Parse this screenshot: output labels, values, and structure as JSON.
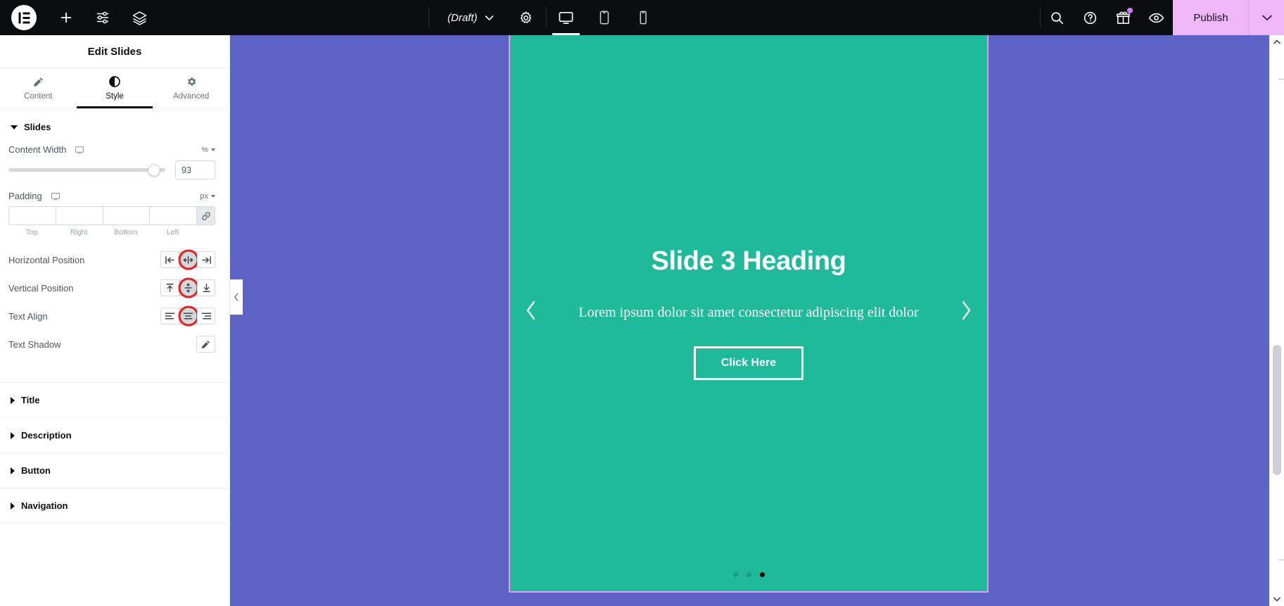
{
  "topbar": {
    "logo_icon": "elementor-logo-icon",
    "add_icon": "plus-icon",
    "settings_sliders_icon": "sliders-icon",
    "layers_icon": "layers-icon",
    "status_label": "(Draft)",
    "status_caret_icon": "chevron-down-icon",
    "page_settings_icon": "gear-icon",
    "devices": [
      {
        "name": "desktop",
        "icon": "desktop-icon",
        "active": true
      },
      {
        "name": "tablet",
        "icon": "tablet-icon",
        "active": false
      },
      {
        "name": "mobile",
        "icon": "mobile-icon",
        "active": false
      }
    ],
    "search_icon": "search-icon",
    "help_icon": "help-circle-icon",
    "gift_icon": "gift-icon",
    "preview_icon": "eye-icon",
    "publish_label": "Publish",
    "publish_caret_icon": "chevron-down-icon",
    "bg_color": "#0c0d0e",
    "publish_color": "#f0b7f8"
  },
  "panel": {
    "title": "Edit Slides",
    "tabs": [
      {
        "label": "Content",
        "icon": "pencil-icon",
        "active": false
      },
      {
        "label": "Style",
        "icon": "contrast-icon",
        "active": true
      },
      {
        "label": "Advanced",
        "icon": "gear-icon",
        "active": false
      }
    ],
    "section_slides": {
      "label": "Slides",
      "expanded": true,
      "content_width": {
        "label": "Content Width",
        "responsive_icon": "desktop-icon",
        "unit": "%",
        "unit_caret_icon": "chevron-down-icon",
        "value": "93",
        "slider_percent": 93
      },
      "padding": {
        "label": "Padding",
        "responsive_icon": "desktop-icon",
        "unit": "px",
        "unit_caret_icon": "chevron-down-icon",
        "values": [
          "",
          "",
          "",
          ""
        ],
        "sides": [
          "Top",
          "Right",
          "Bottom",
          "Left"
        ],
        "link_icon": "link-icon",
        "link_active": true
      },
      "horizontal_position": {
        "label": "Horizontal Position",
        "options": [
          {
            "name": "left",
            "icon": "align-h-left-icon",
            "selected": false,
            "annotated": false
          },
          {
            "name": "center",
            "icon": "align-h-center-icon",
            "selected": true,
            "annotated": true
          },
          {
            "name": "right",
            "icon": "align-h-right-icon",
            "selected": false,
            "annotated": false
          }
        ]
      },
      "vertical_position": {
        "label": "Vertical Position",
        "options": [
          {
            "name": "top",
            "icon": "align-v-top-icon",
            "selected": false,
            "annotated": false
          },
          {
            "name": "middle",
            "icon": "align-v-middle-icon",
            "selected": true,
            "annotated": true
          },
          {
            "name": "bottom",
            "icon": "align-v-bottom-icon",
            "selected": false,
            "annotated": false
          }
        ]
      },
      "text_align": {
        "label": "Text Align",
        "options": [
          {
            "name": "left",
            "icon": "text-align-left-icon",
            "selected": false,
            "annotated": false
          },
          {
            "name": "center",
            "icon": "text-align-center-icon",
            "selected": true,
            "annotated": true
          },
          {
            "name": "right",
            "icon": "text-align-right-icon",
            "selected": false,
            "annotated": false
          }
        ]
      },
      "text_shadow": {
        "label": "Text Shadow",
        "edit_icon": "pencil-icon"
      }
    },
    "accordion": [
      {
        "label": "Title",
        "expanded": false
      },
      {
        "label": "Description",
        "expanded": false
      },
      {
        "label": "Button",
        "expanded": false
      },
      {
        "label": "Navigation",
        "expanded": false
      }
    ],
    "annotation_color": "#e8201f"
  },
  "canvas": {
    "bg_color": "#5c63c4",
    "selection_color": "#e49bf5",
    "slide": {
      "bg_color": "#1fba99",
      "heading": "Slide 3 Heading",
      "description": "Lorem ipsum dolor sit amet consectetur adipiscing elit dolor",
      "button_label": "Click Here",
      "prev_icon": "chevron-left-icon",
      "next_icon": "chevron-right-icon",
      "dots": [
        {
          "index": 1,
          "active": false
        },
        {
          "index": 2,
          "active": false
        },
        {
          "index": 3,
          "active": true
        }
      ]
    },
    "collapse_icon": "chevron-left-icon"
  },
  "scrollbar": {
    "up_icon": "chevron-up-icon",
    "down_icon": "chevron-down-icon"
  }
}
